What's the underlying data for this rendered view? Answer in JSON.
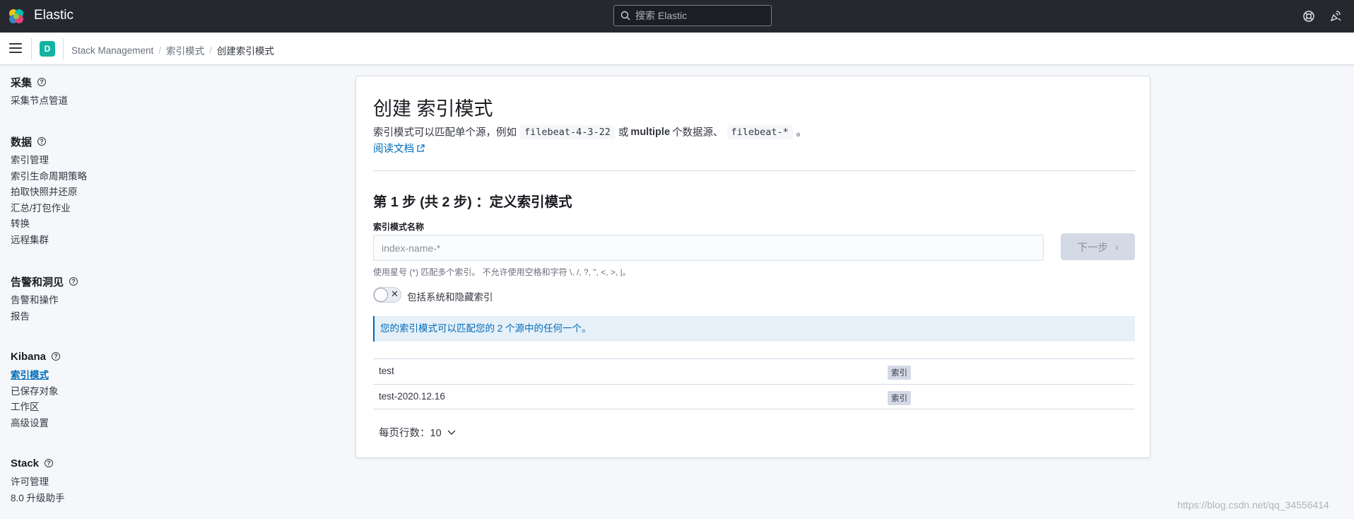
{
  "header": {
    "brand": "Elastic",
    "search_placeholder": "搜索 Elastic",
    "icons": [
      "elastic-logo-icon",
      "search-icon",
      "help-menu-icon",
      "newsfeed-icon"
    ]
  },
  "breadcrumb": {
    "space_avatar": "D",
    "items": [
      "Stack Management",
      "索引模式",
      "创建索引模式"
    ]
  },
  "sidebar": {
    "sections": [
      {
        "title": "采集",
        "items": [
          "采集节点管道"
        ]
      },
      {
        "title": "数据",
        "items": [
          "索引管理",
          "索引生命周期策略",
          "拍取快照并还原",
          "汇总/打包作业",
          "转换",
          "远程集群"
        ]
      },
      {
        "title": "告警和洞见",
        "items": [
          "告警和操作",
          "报告"
        ]
      },
      {
        "title": "Kibana",
        "items": [
          "索引模式",
          "已保存对象",
          "工作区",
          "高级设置"
        ]
      },
      {
        "title": "Stack",
        "items": [
          "许可管理",
          "8.0 升级助手"
        ]
      }
    ],
    "active_item": "索引模式"
  },
  "main": {
    "title": "创建 索引模式",
    "desc_part1": "索引模式可以匹配单个源，例如",
    "desc_code1": "filebeat-4-3-22",
    "desc_part2": "或",
    "desc_bold": "multiple",
    "desc_part3": "个数据源、",
    "desc_code2": "filebeat-*",
    "desc_part4": "。",
    "doc_link": "阅读文档",
    "step_title": "第 1 步 (共 2 步) ：定义索引模式",
    "field_label": "索引模式名称",
    "input_placeholder": "index-name-*",
    "input_value": "",
    "next_button": "下一步",
    "help_text": "使用星号 (*) 匹配多个索引。 不允许使用空格和字符 \\, /, ?, \", <, >, |。",
    "toggle_label": "包括系统和隐藏索引",
    "toggle_on": false,
    "callout": "您的索引模式可以匹配您的 2 个源中的任何一个。",
    "rows": [
      {
        "name": "test",
        "type": "索引"
      },
      {
        "name": "test-2020.12.16",
        "type": "索引"
      }
    ],
    "rows_per_page": "每页行数：10"
  },
  "watermark": "https://blog.csdn.net/qq_34556414"
}
